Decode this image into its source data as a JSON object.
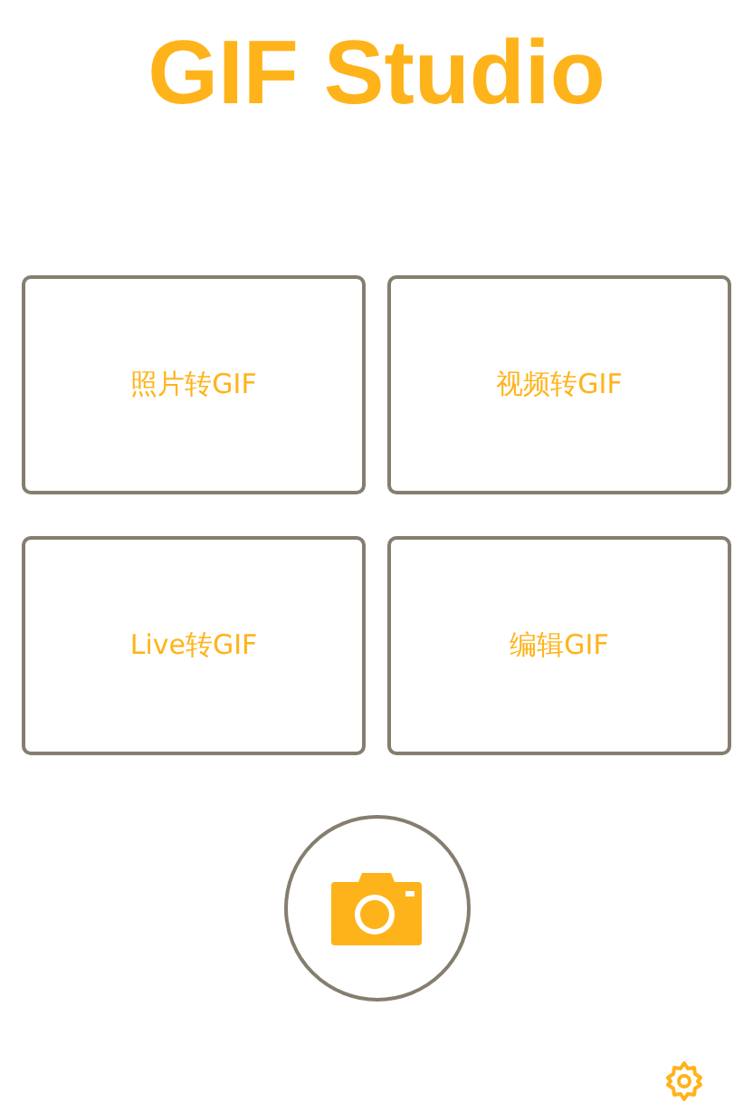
{
  "title": "GIF Studio",
  "actions": [
    {
      "label": "照片转GIF"
    },
    {
      "label": "视频转GIF"
    },
    {
      "label": "Live转GIF"
    },
    {
      "label": "编辑GIF"
    }
  ]
}
